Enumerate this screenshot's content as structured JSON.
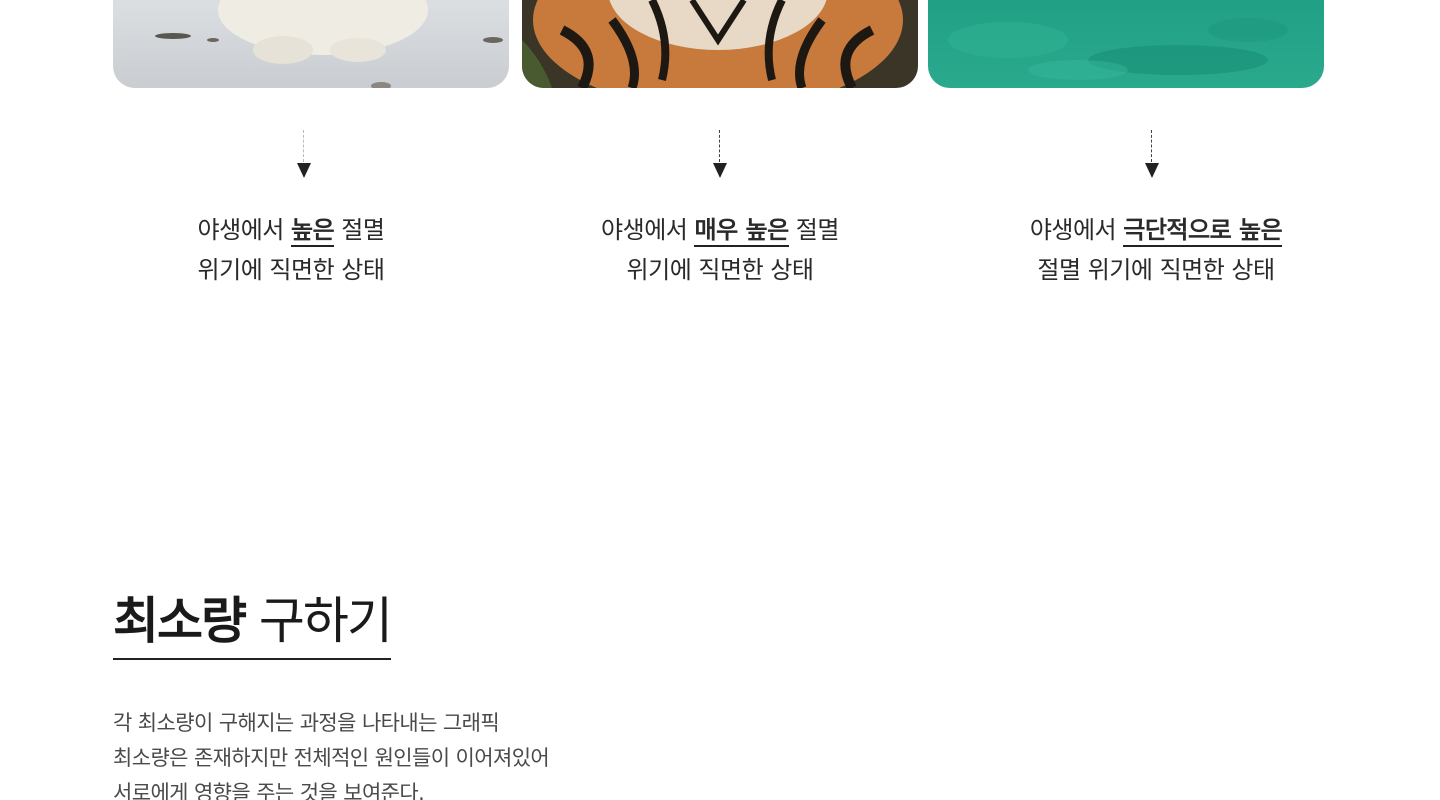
{
  "cards": [
    {
      "image_subject": "polar bear on snow",
      "caption_before": "야생에서 ",
      "caption_emphasis": "높은",
      "caption_after": " 절멸",
      "caption_line2": "위기에 직면한 상태"
    },
    {
      "image_subject": "tiger",
      "caption_before": "야생에서 ",
      "caption_emphasis": "매우 높은",
      "caption_after": " 절멸",
      "caption_line2": "위기에 직면한 상태"
    },
    {
      "image_subject": "sea turtle in green water",
      "caption_before": "야생에서 ",
      "caption_emphasis": "극단적으로 높은",
      "caption_after": "",
      "caption_line2": "절멸 위기에 직면한 상태"
    }
  ],
  "section": {
    "title_bold": "최소량",
    "title_rest": " 구하기",
    "description": [
      "각 최소량이 구해지는 과정을 나타내는 그래픽",
      "최소량은 존재하지만 전체적인 원인들이 이어져있어",
      "서로에게 영향을 주는 것을 보여준다."
    ]
  },
  "colors": {
    "text_primary": "#222222",
    "text_secondary": "#4a4a4a",
    "arrow": "#222222"
  },
  "icons": [
    "arrow-down-icon",
    "arrow-down-icon",
    "arrow-down-icon"
  ]
}
